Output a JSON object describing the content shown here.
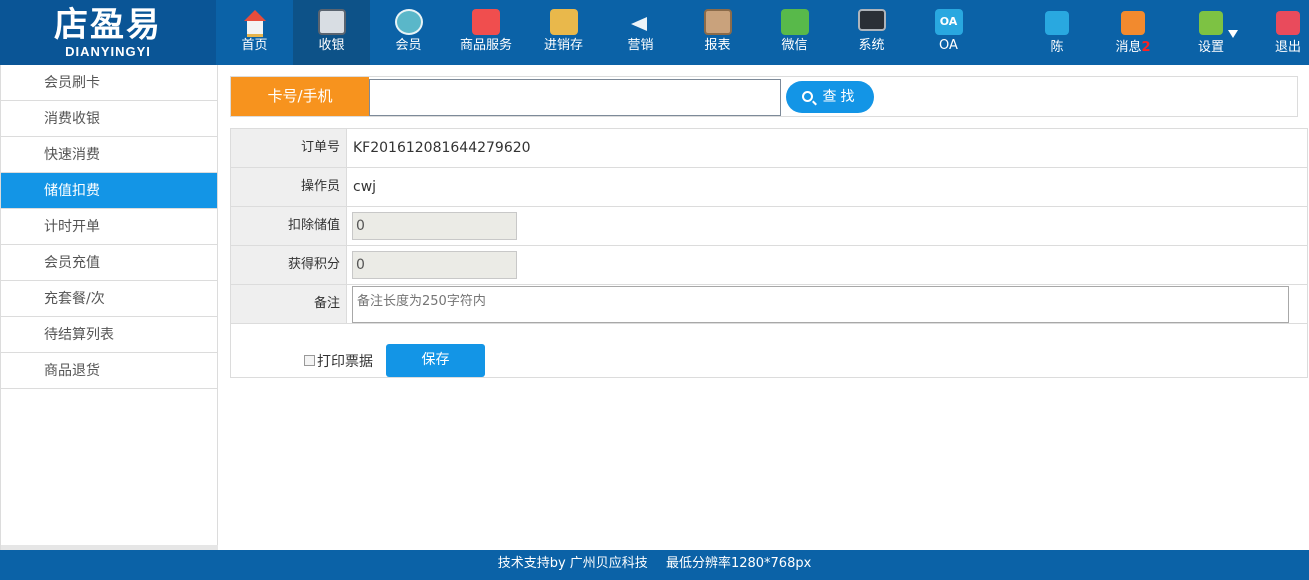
{
  "logo": {
    "cn": "店盈易",
    "en": "DIANYINGYI"
  },
  "nav": [
    {
      "label": "首页",
      "icon": "home-icon"
    },
    {
      "label": "收银",
      "icon": "cash-register-icon",
      "active": true
    },
    {
      "label": "会员",
      "icon": "member-icon"
    },
    {
      "label": "商品服务",
      "icon": "goods-icon"
    },
    {
      "label": "进销存",
      "icon": "inventory-icon"
    },
    {
      "label": "营销",
      "icon": "megaphone-icon"
    },
    {
      "label": "报表",
      "icon": "report-icon"
    },
    {
      "label": "微信",
      "icon": "wechat-icon"
    },
    {
      "label": "系统",
      "icon": "monitor-icon"
    },
    {
      "label": "OA",
      "icon": "oa-icon",
      "icon_text": "OA"
    }
  ],
  "user": {
    "name": "陈"
  },
  "messages": {
    "label": "消息",
    "count": "2"
  },
  "settings": {
    "label": "设置"
  },
  "logout": {
    "label": "退出"
  },
  "sidebar": {
    "items": [
      {
        "label": "会员刷卡"
      },
      {
        "label": "消费收银"
      },
      {
        "label": "快速消费"
      },
      {
        "label": "储值扣费",
        "active": true
      },
      {
        "label": "计时开单"
      },
      {
        "label": "会员充值"
      },
      {
        "label": "充套餐/次"
      },
      {
        "label": "待结算列表"
      },
      {
        "label": "商品退货"
      }
    ]
  },
  "search": {
    "label": "卡号/手机",
    "value": "",
    "placeholder": "",
    "button": "查找"
  },
  "form": {
    "order_label": "订单号",
    "order_value": "KF201612081644279620",
    "operator_label": "操作员",
    "operator_value": "cwj",
    "deduct_label": "扣除储值",
    "deduct_value": "0",
    "points_label": "获得积分",
    "points_value": "0",
    "remark_label": "备注",
    "remark_placeholder": "备注长度为250字符内",
    "print_label": "打印票据",
    "print_checked": false,
    "save_label": "保存"
  },
  "footer": {
    "support": "技术支持by 广州贝应科技",
    "resolution": "最低分辨率1280*768px"
  },
  "colors": {
    "topbar": "#0b62a7",
    "accent": "#1395e6",
    "search_label": "#f7931e"
  }
}
